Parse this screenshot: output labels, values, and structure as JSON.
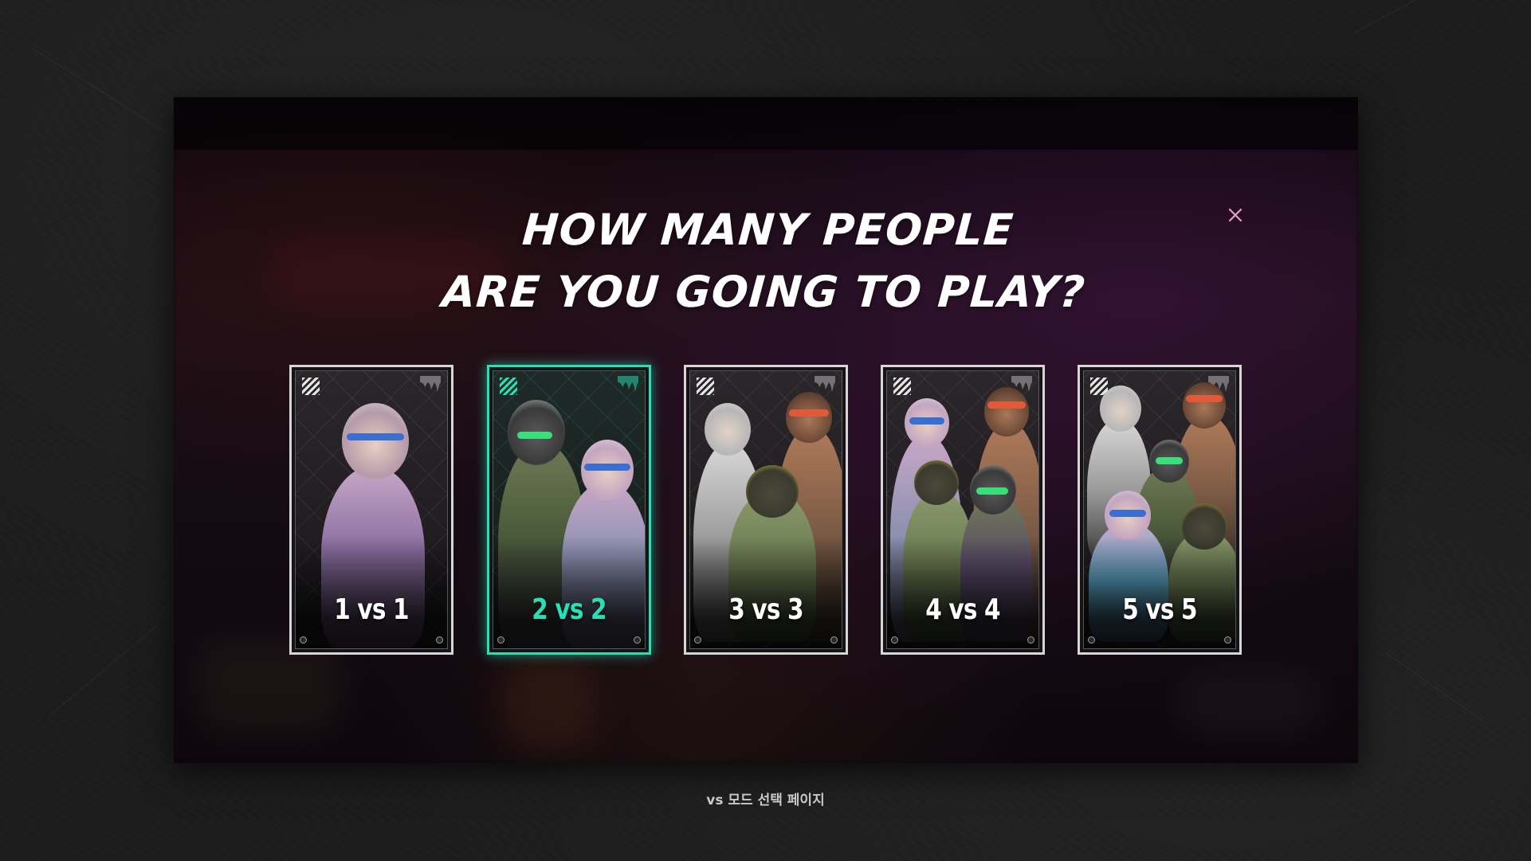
{
  "modal": {
    "title_line1": "HOW MANY PEOPLE",
    "title_line2": "ARE YOU GOING TO PLAY?",
    "close_icon": "close-icon"
  },
  "modes": [
    {
      "label": "1 vs 1",
      "players": 1,
      "selected": false
    },
    {
      "label": "2 vs 2",
      "players": 2,
      "selected": true
    },
    {
      "label": "3 vs 3",
      "players": 3,
      "selected": false
    },
    {
      "label": "4 vs 4",
      "players": 4,
      "selected": false
    },
    {
      "label": "5 vs 5",
      "players": 5,
      "selected": false
    }
  ],
  "caption": "vs 모드 선택 페이지",
  "colors": {
    "accent": "#27e0b6",
    "card_border": "#d6d6d6",
    "close": "#e8a0c0",
    "background": "#1c1c1c"
  }
}
